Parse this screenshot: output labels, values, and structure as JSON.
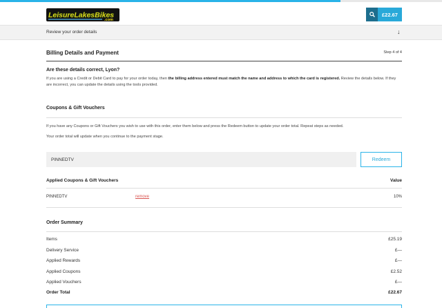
{
  "header": {
    "logo_text": "LeisureLakesBikes.com",
    "cart_total": "£22.67",
    "search_icon": "search-icon",
    "progress_fraction": 0.77
  },
  "review_bar": {
    "label": "Review your order details",
    "arrow": "↓"
  },
  "billing": {
    "title": "Billing Details and Payment",
    "step": "Step 4 of 4",
    "question": "Are these details correct, Lyon?",
    "para_part1": "If you are using a Credit or Debit Card to pay for your order today, then ",
    "para_bold": "the billing address entered must match the name and address to which the card is registered.",
    "para_part2": "  Review the details below. If they are incorrect, you can update the details using the tools provided."
  },
  "coupons": {
    "title": "Coupons & Gift Vouchers",
    "para1": "If you have any Coupons or Gift Vouchers you wish to use with this order, enter them below and press the Redeem button to update your order total. Repeat steps as needed.",
    "para2": "Your order total will update when you continue to the payment stage.",
    "input_value": "PINNEDTV",
    "redeem_label": "Redeem",
    "applied_heading": "Applied Coupons & Gift Vouchers",
    "value_heading": "Value",
    "applied": [
      {
        "code": "PINNEDTV",
        "remove_label": "remove",
        "value": "10%"
      }
    ]
  },
  "summary": {
    "title": "Order Summary",
    "rows": [
      {
        "label": "Items",
        "value": "£25.19"
      },
      {
        "label": "Delivery Service",
        "value": "£—"
      },
      {
        "label": "Applied Rewards",
        "value": "£—"
      },
      {
        "label": "Applied Coupons",
        "value": "£2.52"
      },
      {
        "label": "Applied Vouchers",
        "value": "£—"
      }
    ],
    "total_label": "Order Total",
    "total_value": "£22.67"
  },
  "colors": {
    "accent": "#29b3e8",
    "dark_accent": "#1d6e8e",
    "remove_red": "#d9534f"
  }
}
